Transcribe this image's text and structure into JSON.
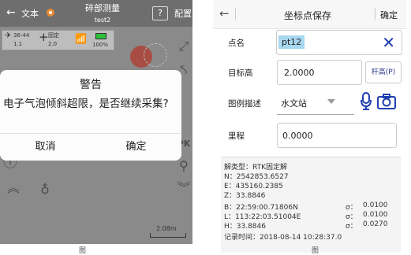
{
  "left": {
    "topbar": {
      "back_glyph": "←",
      "text_label": "文本",
      "title": "碎部测量",
      "subtitle": "test2",
      "help_label": "?",
      "config_label": "配置"
    },
    "status": {
      "sats": "36-44",
      "sats_value": "1.1",
      "fix_label": "固定",
      "fix_value": "2.0",
      "battery_label": "100%"
    },
    "alert": {
      "title": "警告",
      "message": "电子气泡倾斜超限，是否继续采集?",
      "cancel_label": "取消",
      "confirm_label": "确定"
    },
    "side_labels": {
      "pk_label": "PK"
    },
    "scale_label": "2.08m"
  },
  "right": {
    "topbar": {
      "back_glyph": "←",
      "title": "坐标点保存",
      "confirm_label": "确定"
    },
    "form": {
      "name_label": "点名",
      "name_value": "pt12",
      "height_label": "目标高",
      "height_value": "2.0000",
      "pole_button_label": "杆高(P)",
      "legend_label": "图例描述",
      "legend_value": "水文站",
      "mileage_label": "里程",
      "mileage_value": "0.0000"
    },
    "info": {
      "solution": "解类型：RTK固定解",
      "n": "N：2542853.6527",
      "e": "E：435160.2385",
      "z": "Z：33.8846",
      "b": "B：22:59:00.71806N",
      "l": "L：113:22:03.51004E",
      "h": "H：33.8846",
      "sigma_b": "σ：",
      "sigma_b_val": "0.0100",
      "sigma_l": "σ：",
      "sigma_l_val": "0.0100",
      "sigma_h": "σ：",
      "sigma_h_val": "0.0270",
      "record_time": "记录时间：2018-08-14 10:28:37.0"
    }
  },
  "captions": {
    "left": "图",
    "right": "图"
  },
  "colors": {
    "accent_blue": "#1f3fb0",
    "highlight": "#a8d8f0",
    "map_dot": "#a84d43",
    "battery_green": "#2fbf3a"
  }
}
